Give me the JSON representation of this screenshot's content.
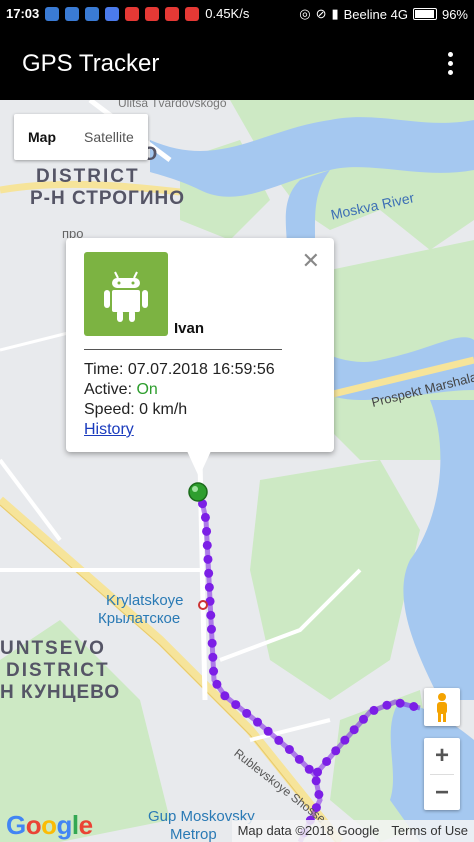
{
  "status_bar": {
    "time": "17:03",
    "network_speed": "0.45K/s",
    "carrier": "Beeline 4G",
    "battery": "96%"
  },
  "app_bar": {
    "title": "GPS Tracker",
    "menu_icon": "more-vert-icon"
  },
  "map_type": {
    "options": [
      "Map",
      "Satellite"
    ],
    "selected": "Map"
  },
  "map_labels": {
    "street_top": "Ulitsa Tvardovskogo",
    "district_1": "STROGINO",
    "district_2": "DISTRICT",
    "district_ru": "Р-Н СТРОГИНО",
    "river": "Moskva River",
    "avenue": "Prospekt Marshala",
    "metro_en": "Krylatskoye",
    "metro_ru": "Крылатское",
    "district2_1": "UNTSEVO",
    "district2_2": "DISTRICT",
    "district2_ru": "Н КУНЦЕВО",
    "highway": "Rublevskoye Shosse",
    "bottom_place_1": "Gup Moskovsky",
    "bottom_place_2": "Metrop",
    "partial_left": "про"
  },
  "info_window": {
    "name": "Ivan",
    "time_label": "Time:",
    "time_value": "07.07.2018 16:59:56",
    "active_label": "Active:",
    "active_value": "On",
    "speed_label": "Speed:",
    "speed_value": "0 km/h",
    "history_link": "History",
    "avatar_icon": "android-icon",
    "close_icon": "close-icon"
  },
  "controls": {
    "zoom_in": "+",
    "zoom_out": "−",
    "pegman_icon": "street-view-pegman-icon"
  },
  "footer": {
    "logo": "Google",
    "map_data": "Map data ©2018 Google",
    "terms": "Terms of Use"
  },
  "colors": {
    "track": "#7c1fe6",
    "marker": "#2e9e2e",
    "water": "#a5c8f0",
    "park": "#cde9c4",
    "road": "#ffffff",
    "highway": "#f6e49a"
  }
}
